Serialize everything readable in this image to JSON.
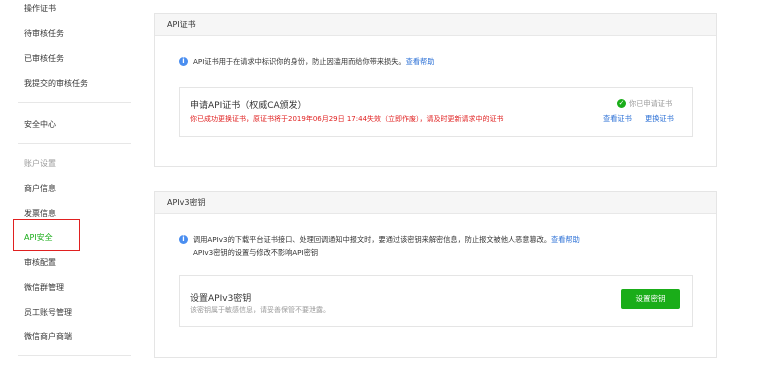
{
  "sidebar": {
    "items": [
      {
        "label": "操作证书"
      },
      {
        "label": "待审核任务"
      },
      {
        "label": "已审核任务"
      },
      {
        "label": "我提交的审核任务"
      },
      {
        "label": "安全中心"
      }
    ],
    "group_label": "账户设置",
    "account_items": [
      {
        "label": "商户信息"
      },
      {
        "label": "发票信息"
      },
      {
        "label": "API安全"
      },
      {
        "label": "审核配置"
      },
      {
        "label": "微信群管理"
      },
      {
        "label": "员工账号管理"
      },
      {
        "label": "微信商户商端"
      }
    ],
    "active_label": "API安全"
  },
  "api_cert": {
    "header": "API证书",
    "info_text": "API证书用于在请求中标识你的身份，防止因滥用而给你带来损失。",
    "help_link": "查看帮助",
    "card_title": "申请API证书（权威CA颁发）",
    "warning": "你已成功更换证书，原证书将于2019年06月29日 17:44失效（立即作废），请及时更新请求中的证书",
    "status": "你已申请证书",
    "view_link": "查看证书",
    "change_link": "更换证书"
  },
  "apiv3": {
    "header": "APIv3密钥",
    "info_line1": "调用APIv3的下载平台证书接口、处理回调通知中报文时，要通过该密钥来解密信息，防止报文被他人恶意篡改。",
    "help_link": "查看帮助",
    "info_line2": "APIv3密钥的设置与修改不影响API密钥",
    "card_title": "设置APIv3密钥",
    "card_desc": "该密钥属于敏感信息，请妥善保管不要泄露。",
    "button": "设置密钥"
  },
  "colors": {
    "accent": "#1aad19",
    "link": "#2a6fd6",
    "warning": "#e02020",
    "highlight_box": "#e02020"
  },
  "icons": {
    "info": "info-icon",
    "success": "check-circle-icon"
  }
}
